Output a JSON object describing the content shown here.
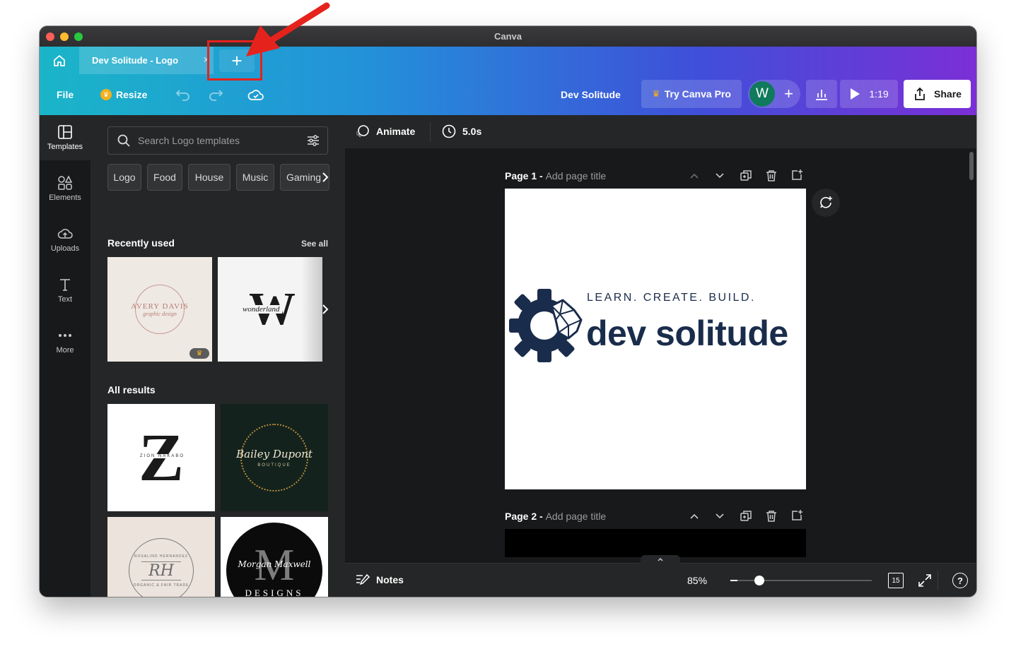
{
  "window": {
    "title": "Canva"
  },
  "tabs": {
    "active_label": "Dev Solitude - Logo",
    "close": "×",
    "new_tab": "+"
  },
  "toolbar": {
    "file": "File",
    "resize": "Resize",
    "design_name": "Dev Solitude",
    "try_pro": "Try Canva Pro",
    "avatar_initial": "W",
    "add_people": "+",
    "present_time": "1:19",
    "share": "Share"
  },
  "sidebar": {
    "items": [
      {
        "label": "Templates",
        "icon": "templates-icon"
      },
      {
        "label": "Elements",
        "icon": "elements-icon"
      },
      {
        "label": "Uploads",
        "icon": "uploads-icon"
      },
      {
        "label": "Text",
        "icon": "text-icon"
      },
      {
        "label": "More",
        "icon": "more-icon"
      }
    ]
  },
  "panel": {
    "search_placeholder": "Search Logo templates",
    "chips": [
      "Logo",
      "Food",
      "House",
      "Music",
      "Gaming"
    ],
    "recently_used": "Recently used",
    "see_all": "See all",
    "all_results": "All results",
    "thumbs": {
      "avery_line1": "AVERY DAVIS",
      "avery_line2": "graphic design",
      "wonder_letter": "W",
      "wonder_word": "wonderland",
      "zion_letter": "Z",
      "zion_name": "ZION NAKABO",
      "bailey_name": "Bailey Dupont",
      "bailey_sub": "BOUTIQUE",
      "rh_letters": "RH",
      "rh_top": "ROSALIND HERNANDEZ",
      "rh_bottom": "ORGANIC & FAIR TRADE",
      "m_letter": "M",
      "m_name": "Morgan Maxwell",
      "m_sub": "DESIGNS"
    }
  },
  "canvas_toolbar": {
    "animate": "Animate",
    "duration": "5.0s"
  },
  "pages": [
    {
      "label": "Page 1 -",
      "title_placeholder": "Add page title"
    },
    {
      "label": "Page 2 -",
      "title_placeholder": "Add page title"
    }
  ],
  "logo": {
    "tagline": "LEARN. CREATE. BUILD.",
    "wordmark": "dev solitude",
    "color": "#1a2c4b"
  },
  "bottom": {
    "notes": "Notes",
    "zoom": "85%",
    "page_count": "15",
    "zoom_fraction": 0.05
  },
  "colors": {
    "annotation": "#e6221c",
    "share_bg": "#ffffff",
    "avatar": "#0f7a5c"
  }
}
